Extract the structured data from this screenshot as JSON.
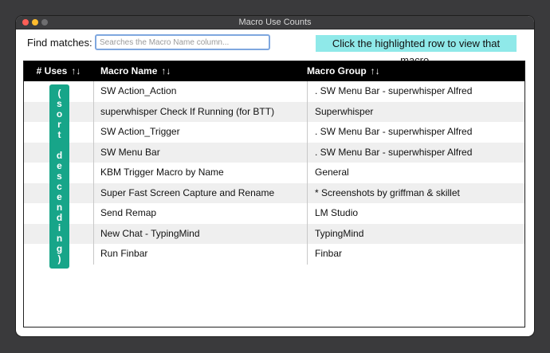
{
  "window": {
    "title": "Macro Use Counts"
  },
  "search": {
    "label": "Find matches:",
    "placeholder": "Searches the Macro Name column...",
    "value": ""
  },
  "hint": "Click the highlighted row to view that macro.",
  "table": {
    "columns": [
      {
        "label": "# Uses",
        "arrows": "↑↓"
      },
      {
        "label": "Macro Name",
        "arrows": "↑↓"
      },
      {
        "label": "Macro Group",
        "arrows": "↑↓"
      }
    ],
    "rows": [
      {
        "uses": "",
        "name": "SW Action_Action",
        "group": ". SW Menu Bar - superwhisper Alfred"
      },
      {
        "uses": "",
        "name": "superwhisper Check If Running (for BTT)",
        "group": "Superwhisper"
      },
      {
        "uses": "",
        "name": "SW Action_Trigger",
        "group": ". SW Menu Bar - superwhisper Alfred"
      },
      {
        "uses": "",
        "name": "SW Menu Bar",
        "group": ". SW Menu Bar - superwhisper Alfred"
      },
      {
        "uses": "",
        "name": "KBM Trigger Macro by Name",
        "group": "General"
      },
      {
        "uses": "",
        "name": "Super Fast Screen Capture and Rename",
        "group": "* Screenshots by griffman & skillet"
      },
      {
        "uses": "",
        "name": "Send Remap",
        "group": "LM Studio"
      },
      {
        "uses": "",
        "name": "New Chat - TypingMind",
        "group": "TypingMind"
      },
      {
        "uses": "",
        "name": "Run Finbar",
        "group": "Finbar"
      }
    ]
  },
  "tooltip": "(sort descending)",
  "colors": {
    "hint_bg": "#8fe9e9",
    "tooltip_bg": "#17a589",
    "header_bg": "#000000",
    "search_border": "#7fa7df"
  },
  "icons": [
    "close-icon",
    "minimize-icon",
    "maximize-icon"
  ]
}
